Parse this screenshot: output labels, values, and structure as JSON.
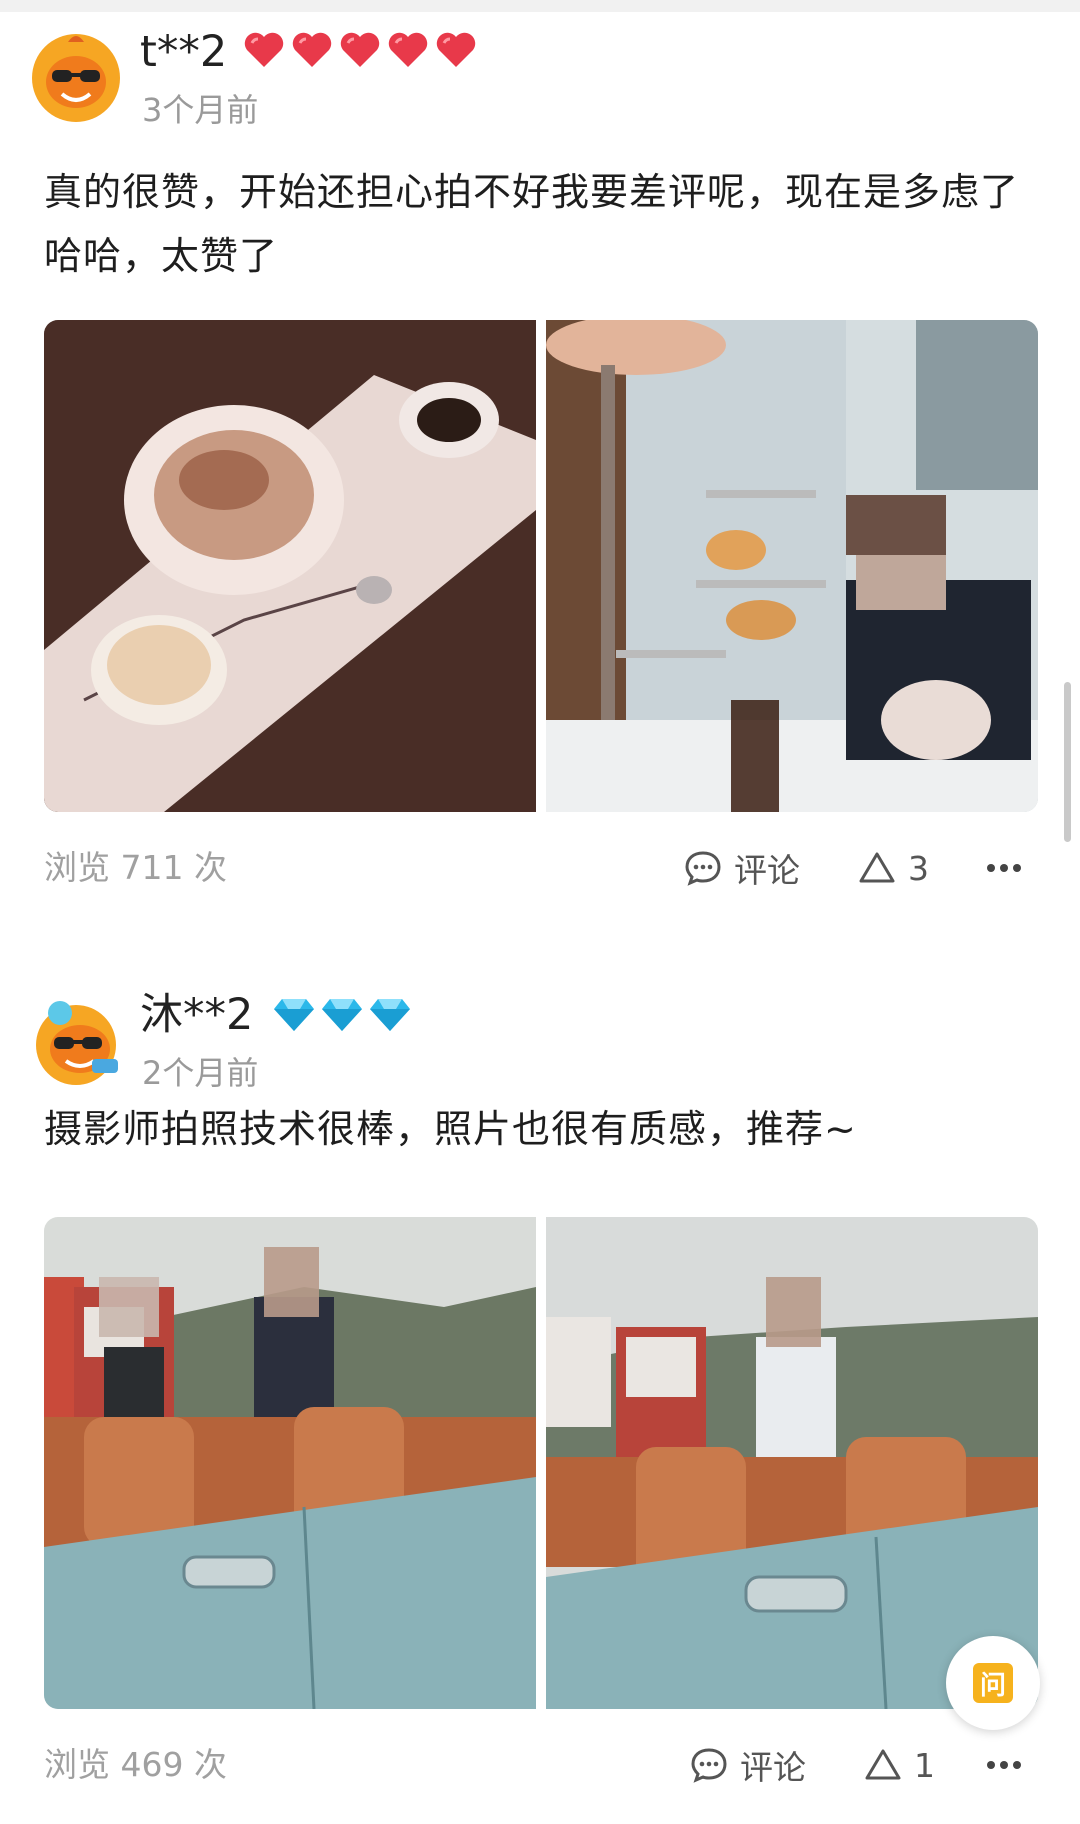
{
  "reviews": [
    {
      "username": "t**2",
      "badge_type": "heart",
      "badge_count": 5,
      "time": "3个月前",
      "text": "真的很赞，开始还担心拍不好我要差评呢，现在是多虑了哈哈，太赞了",
      "views": "浏览 711 次",
      "comment_label": "评论",
      "like_count": "3"
    },
    {
      "username": "沐**2",
      "badge_type": "diamond",
      "badge_count": 3,
      "time": "2个月前",
      "text": "摄影师拍照技术很棒，照片也很有质感，推荐~",
      "views": "浏览 469 次",
      "comment_label": "评论",
      "like_count": "1"
    }
  ],
  "fab": {
    "label": "问"
  },
  "colors": {
    "heart": "#e8394a",
    "diamond": "#2bb8ea",
    "accent": "#f6b21d",
    "muted": "#9a9a9a"
  }
}
